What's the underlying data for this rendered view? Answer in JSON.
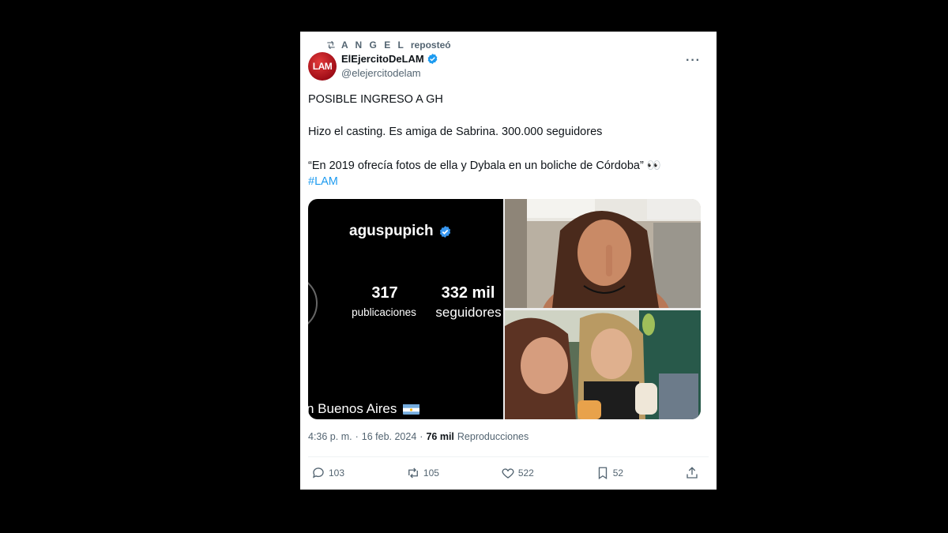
{
  "repost": {
    "user": "A N G E L",
    "verb": "reposteó"
  },
  "author": {
    "avatar_text": "LAM",
    "display_name": "ElEjercitoDeLAM",
    "handle": "@elejercitodelam",
    "verified": true
  },
  "more_label": "···",
  "tweet": {
    "line1": "POSIBLE INGRESO A GH",
    "line2": "Hizo el casting. Es amiga de Sabrina. 300.000 seguidores",
    "line3": "“En 2019 ofrecía fotos de ella y Dybala en un boliche de Córdoba” 👀",
    "hashtag": "#LAM"
  },
  "media": {
    "ig_username": "aguspupich",
    "posts_count": "317",
    "posts_label": "publicaciones",
    "followers_count": "332 mil",
    "followers_label": "seguidores",
    "location": "n Buenos Aires"
  },
  "meta": {
    "time": "4:36 p. m.",
    "separator": "·",
    "date": "16 feb. 2024",
    "views_count": "76 mil",
    "views_label": "Reproducciones"
  },
  "actions": {
    "replies": "103",
    "reposts": "105",
    "likes": "522",
    "bookmarks": "52"
  },
  "colors": {
    "accent": "#1d9bf0",
    "secondary_text": "#536471",
    "avatar_red": "#c8161d"
  }
}
